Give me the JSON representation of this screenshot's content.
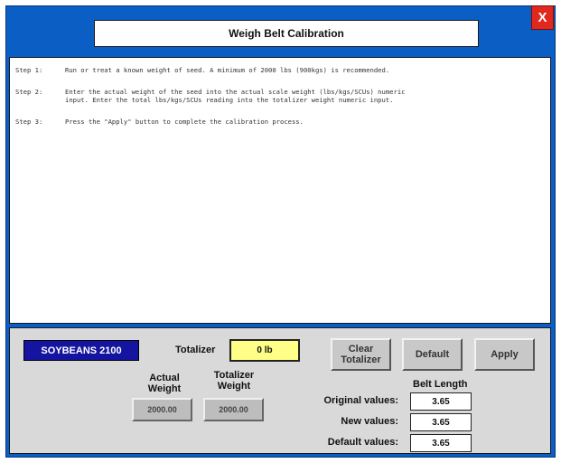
{
  "window": {
    "title": "Weigh Belt Calibration",
    "close_label": "X"
  },
  "instructions": [
    {
      "num": "Step 1:",
      "lines": [
        "Run or treat a known weight of seed. A minimum of 2000 lbs (900kgs) is recommended."
      ]
    },
    {
      "num": "Step 2:",
      "lines": [
        "Enter the actual weight of the seed into the actual scale weight (lbs/kgs/SCUs) numeric",
        "input. Enter the total lbs/kgs/SCUs reading into the totalizer weight numeric input."
      ]
    },
    {
      "num": "Step 3:",
      "lines": [
        "Press the \"Apply\" button to complete the calibration process."
      ]
    }
  ],
  "panel": {
    "crop_label": "SOYBEANS 2100",
    "totalizer_label": "Totalizer",
    "totalizer_value": "0 lb",
    "clear_totalizer_label": "Clear\nTotalizer",
    "default_label": "Default",
    "apply_label": "Apply",
    "actual_weight_label": "Actual\nWeight",
    "totalizer_weight_label": "Totalizer\nWeight",
    "actual_weight_value": "2000.00",
    "totalizer_weight_value": "2000.00",
    "belt_length_header": "Belt Length",
    "rows": [
      {
        "label": "Original values:",
        "value": "3.65"
      },
      {
        "label": "New values:",
        "value": "3.65"
      },
      {
        "label": "Default values:",
        "value": "3.65"
      }
    ]
  },
  "colors": {
    "window_bg": "#0a5ec4",
    "crop_box": "#1414a0",
    "totalizer_box": "#ffff88",
    "close_button": "#e0281f",
    "panel_bg": "#d9d9d9"
  }
}
